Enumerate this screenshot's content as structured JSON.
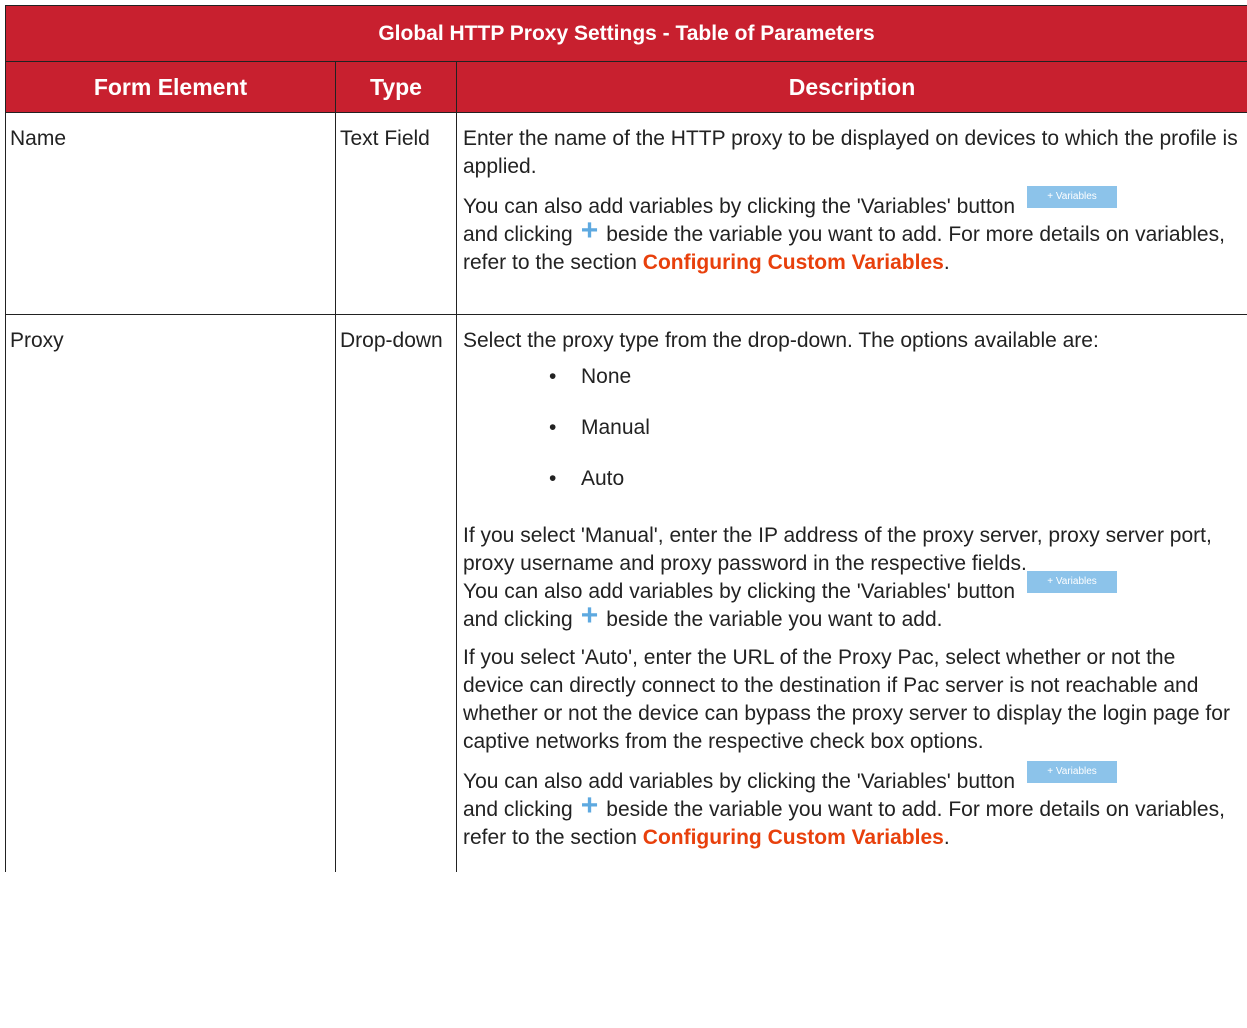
{
  "table": {
    "title": "Global HTTP Proxy Settings - Table of Parameters",
    "headers": [
      "Form Element",
      "Type",
      "Description"
    ]
  },
  "rows": [
    {
      "element": "Name",
      "type": "Text Field",
      "desc_p1": "Enter the name of the HTTP proxy to be displayed on devices to which the profile is applied.",
      "desc_p2_a": "You can also add variables by clicking the 'Variables' button",
      "desc_p2_b": "and clicking",
      "desc_p2_c": "beside the variable you want to add. For more details on variables, refer to the section",
      "desc_p2_link": "Configuring Custom Variables",
      "desc_p2_end": "."
    },
    {
      "element": "Proxy",
      "type": "Drop-down",
      "desc_p1": "Select the proxy type from the drop-down. The options available are:",
      "options": [
        "None",
        "Manual",
        "Auto"
      ],
      "desc_manual": "If you select 'Manual', enter the IP address of the proxy server, proxy server port, proxy username and proxy password in the respective fields.",
      "desc_manual_var_a": "You can also add variables by clicking the 'Variables' button",
      "desc_manual_var_b": "and clicking",
      "desc_manual_var_c": "beside the variable you want to add.",
      "desc_auto": "If you select 'Auto', enter the URL of the Proxy Pac, select whether or not the device can directly connect to the destination if Pac server is not reachable and whether or not the device can bypass the proxy server to display the login page for captive networks from the respective check box options.",
      "desc_auto_var_a": "You can also add variables by clicking the 'Variables' button",
      "desc_auto_var_b": "and clicking",
      "desc_auto_var_c": "beside the variable you want to add. For more details on variables, refer to the section",
      "desc_auto_var_link": "Configuring Custom Variables",
      "desc_auto_var_end": "."
    }
  ],
  "variables_button": {
    "label": "+ Variables",
    "color": "#8cc3ea"
  },
  "plus_icon": {
    "glyph": "+",
    "color": "#5ea9e0"
  },
  "colors": {
    "header_bg": "#c8202f",
    "link": "#e8400c"
  }
}
